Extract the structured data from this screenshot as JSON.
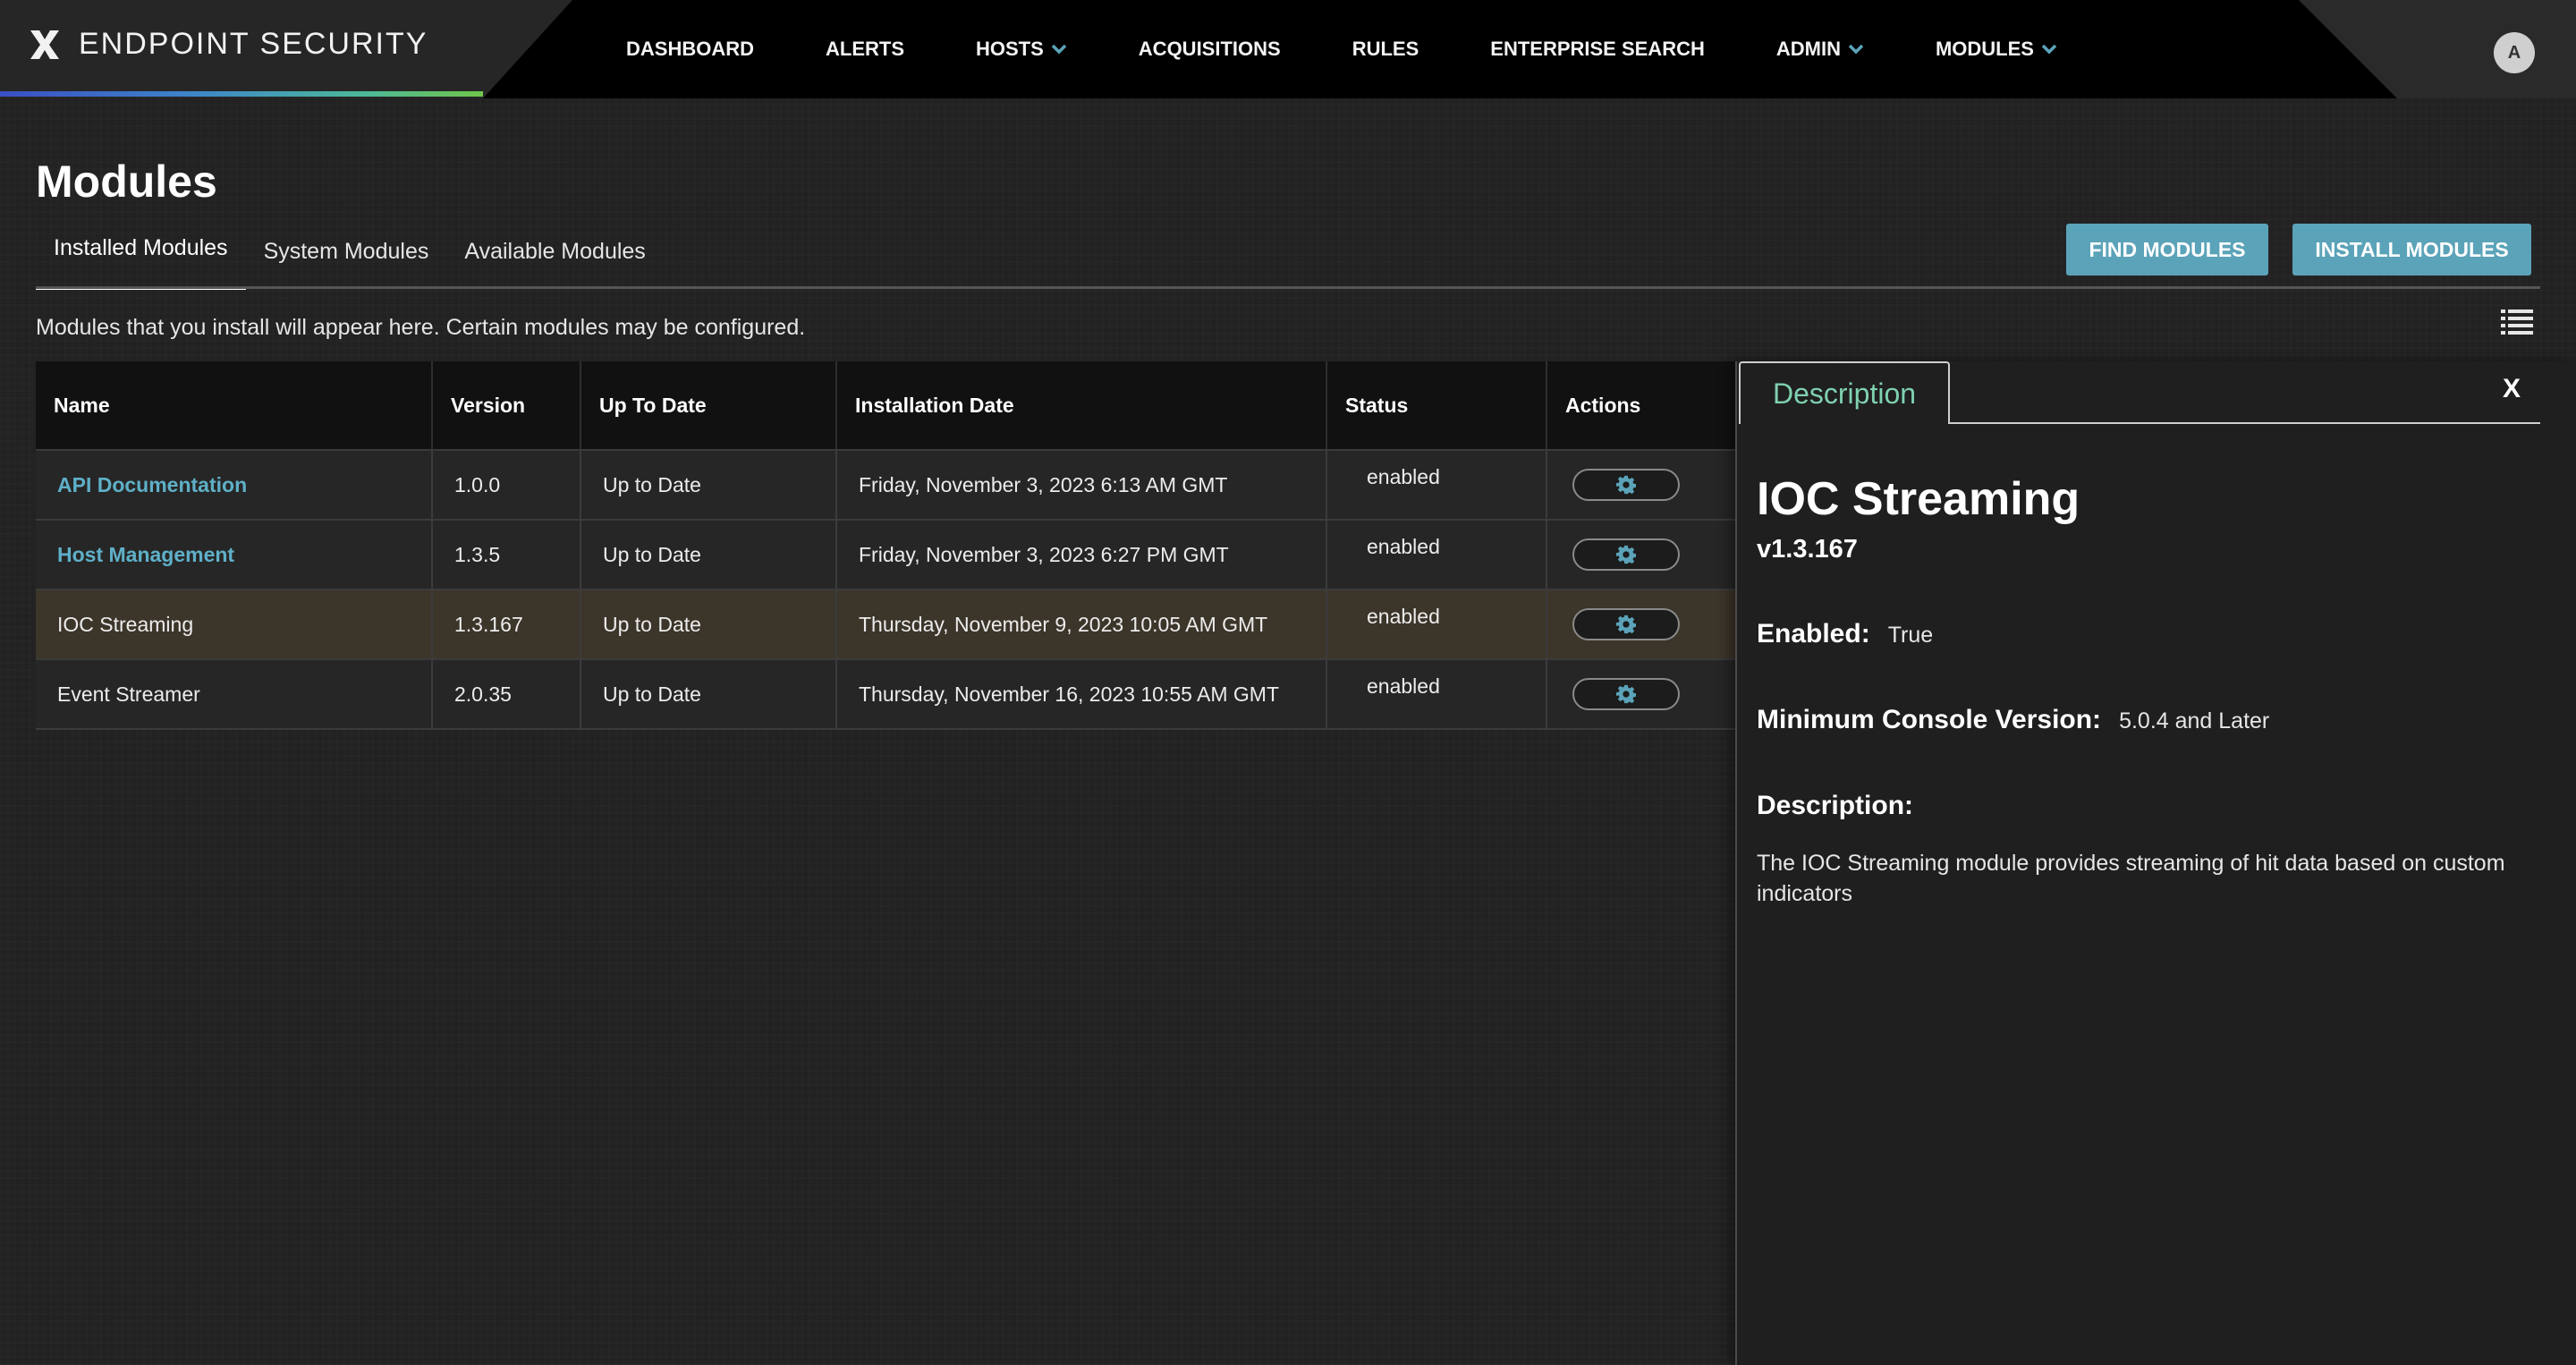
{
  "brand": {
    "title": "ENDPOINT SECURITY",
    "logo_icon": "x-logo-icon"
  },
  "nav": {
    "items": [
      {
        "label": "DASHBOARD",
        "dropdown": false
      },
      {
        "label": "ALERTS",
        "dropdown": false
      },
      {
        "label": "HOSTS",
        "dropdown": true
      },
      {
        "label": "ACQUISITIONS",
        "dropdown": false
      },
      {
        "label": "RULES",
        "dropdown": false
      },
      {
        "label": "ENTERPRISE SEARCH",
        "dropdown": false
      },
      {
        "label": "ADMIN",
        "dropdown": true
      },
      {
        "label": "MODULES",
        "dropdown": true
      }
    ],
    "avatar_initial": "A"
  },
  "page": {
    "title": "Modules",
    "tabs": [
      "Installed Modules",
      "System Modules",
      "Available Modules"
    ],
    "active_tab": "Installed Modules",
    "find_button": "FIND MODULES",
    "install_button": "INSTALL MODULES",
    "subtitle": "Modules that you install will appear here. Certain modules may be configured."
  },
  "table": {
    "columns": [
      "Name",
      "Version",
      "Up To Date",
      "Installation Date",
      "Status",
      "Actions"
    ],
    "rows": [
      {
        "name": "API Documentation",
        "version": "1.0.0",
        "uptodate": "Up to Date",
        "date": "Friday, November 3, 2023 6:13 AM GMT",
        "status": "enabled"
      },
      {
        "name": "Host Management",
        "version": "1.3.5",
        "uptodate": "Up to Date",
        "date": "Friday, November 3, 2023 6:27 PM GMT",
        "status": "enabled"
      },
      {
        "name": "IOC Streaming",
        "version": "1.3.167",
        "uptodate": "Up to Date",
        "date": "Thursday, November 9, 2023 10:05 AM GMT",
        "status": "enabled"
      },
      {
        "name": "Event Streamer",
        "version": "2.0.35",
        "uptodate": "Up to Date",
        "date": "Thursday, November 16, 2023 10:55 AM GMT",
        "status": "enabled"
      }
    ]
  },
  "panel": {
    "tab_label": "Description",
    "close_label": "X",
    "title": "IOC Streaming",
    "version": "v1.3.167",
    "enabled_label": "Enabled:",
    "enabled_value": "True",
    "min_console_label": "Minimum Console Version:",
    "min_console_value": "5.0.4 and Later",
    "description_label": "Description:",
    "description": "The IOC Streaming module provides streaming of hit data based on custom indicators"
  },
  "colors": {
    "accent": "#5ba3b9",
    "link": "#5fb0c8",
    "panel_tab_text": "#7fd1b0",
    "selected_row": "#3c352a"
  }
}
